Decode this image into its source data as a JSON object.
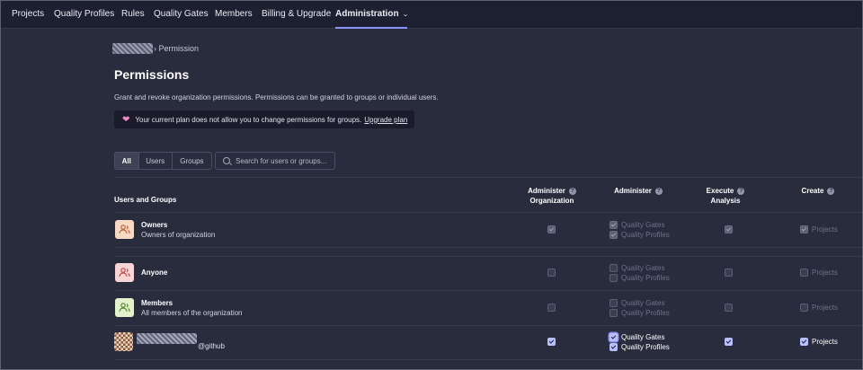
{
  "nav": {
    "items": [
      "Projects",
      "Quality Profiles",
      "Rules",
      "Quality Gates",
      "Members",
      "Billing & Upgrade",
      "Administration"
    ]
  },
  "breadcrumb": {
    "current": "Permission"
  },
  "page": {
    "title": "Permissions",
    "description": "Grant and revoke organization permissions. Permissions can be granted to groups or individual users.",
    "banner_text": "Your current plan does not allow you to change permissions for groups.",
    "banner_link": "Upgrade plan"
  },
  "filters": {
    "tabs": [
      "All",
      "Users",
      "Groups"
    ],
    "active_tab": "All",
    "search_placeholder": "Search for users or groups..."
  },
  "table": {
    "headers": {
      "users_groups": "Users and Groups",
      "admin_org_line1": "Administer",
      "admin_org_line2": "Organization",
      "administer": "Administer",
      "exec_line1": "Execute",
      "exec_line2": "Analysis",
      "create": "Create"
    },
    "perm_labels": {
      "quality_gates": "Quality Gates",
      "quality_profiles": "Quality Profiles",
      "projects": "Projects"
    },
    "rows": [
      {
        "name": "Owners",
        "description": "Owners of organization",
        "admin_org": true,
        "quality_gates": true,
        "quality_profiles": true,
        "execute_analysis": true,
        "projects": true,
        "editable": false
      },
      {
        "name": "Anyone",
        "description": "",
        "admin_org": false,
        "quality_gates": false,
        "quality_profiles": false,
        "execute_analysis": false,
        "projects": false,
        "editable": false
      },
      {
        "name": "Members",
        "description": "All members of the organization",
        "admin_org": false,
        "quality_gates": false,
        "quality_profiles": false,
        "execute_analysis": false,
        "projects": false,
        "editable": false
      },
      {
        "name_suffix": "@github",
        "admin_org": true,
        "quality_gates": true,
        "quality_profiles": true,
        "execute_analysis": true,
        "projects": true,
        "editable": true
      }
    ]
  },
  "colors": {
    "background": "#282c3d",
    "nav_background": "#1d2030",
    "accent": "#8b93f8",
    "checkbox_checked": "#b9beff"
  }
}
